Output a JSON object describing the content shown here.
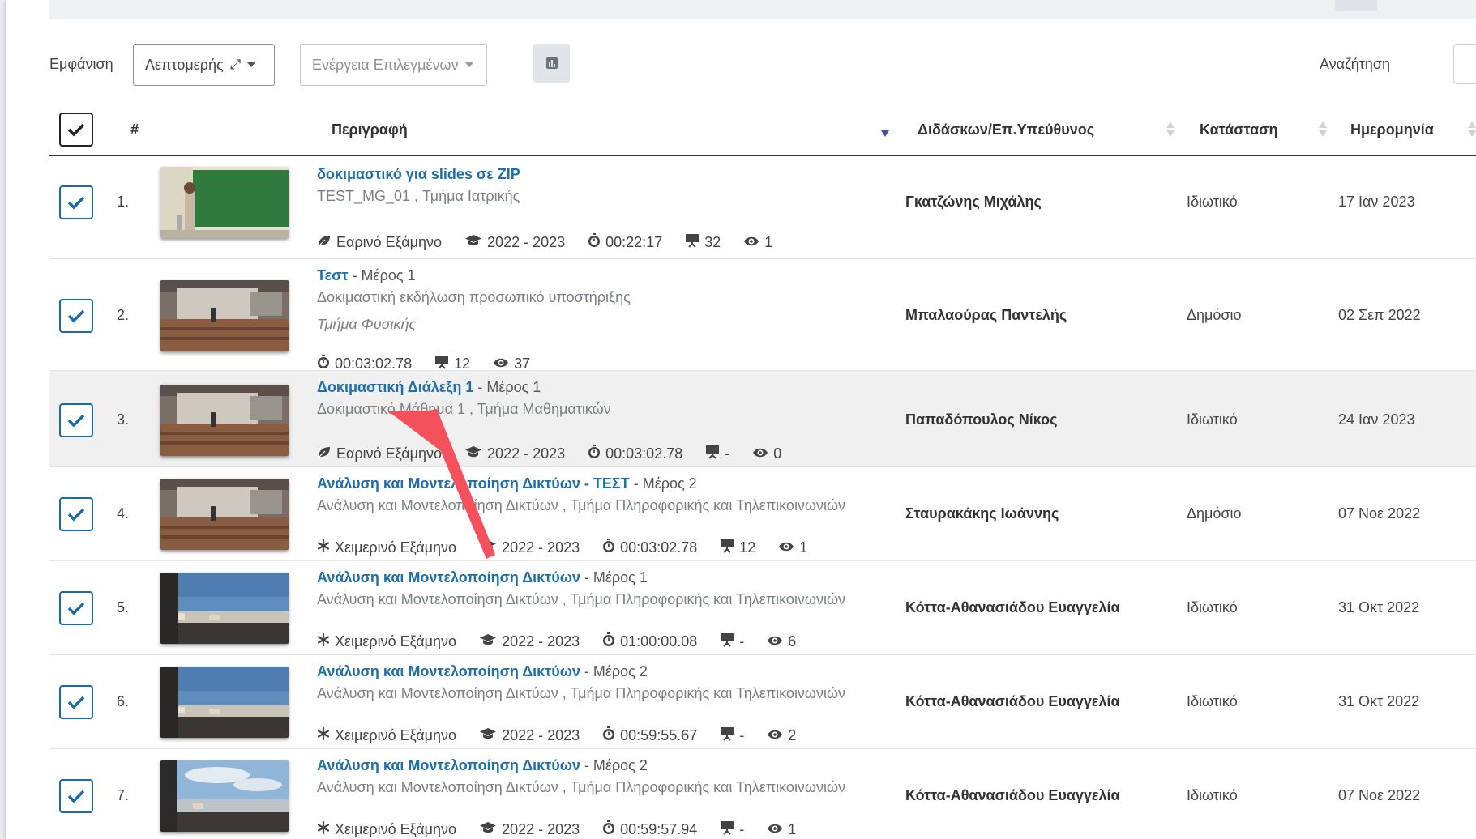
{
  "toolbar": {
    "view_label": "Εμφάνιση",
    "view_value": "Λεπτομερής",
    "bulk_action": "Ενέργεια Επιλεγμένων",
    "search_label": "Αναζήτηση",
    "search_value": ""
  },
  "table": {
    "headers": {
      "index": "#",
      "description": "Περιγραφή",
      "teacher": "Διδάσκων/Επ.Υπεύθυνος",
      "status": "Κατάσταση",
      "date": "Ημερομηνία"
    },
    "sorted_column": "description",
    "rows": [
      {
        "num": "1.",
        "title": "δοκιμαστικό για slides σε ZIP",
        "part": "",
        "subtitle": "TEST_MG_01 , Τμήμα Ιατρικής",
        "subtitle2": "",
        "semester": "Εαρινό Εξάμηνο",
        "semester_icon": "leaf-icon",
        "year": "2022 - 2023",
        "duration": "00:22:17",
        "slides": "32",
        "views": "1",
        "teacher": "Γκατζώνης Μιχάλης",
        "status": "Ιδιωτικό",
        "date": "17 Ιαν 2023",
        "thumb": "board"
      },
      {
        "num": "2.",
        "title": "Τεστ",
        "part": " - Μέρος 1",
        "subtitle": "Δοκιμαστική εκδήλωση προσωπικό υποστήριξης",
        "subtitle2": "Τμήμα Φυσικής",
        "semester": "",
        "semester_icon": "",
        "year": "",
        "duration": "00:03:02.78",
        "slides": "12",
        "views": "37",
        "teacher": "Μπαλαούρας Παντελής",
        "status": "Δημόσιο",
        "date": "02 Σεπ 2022",
        "thumb": "room"
      },
      {
        "num": "3.",
        "title": "Δοκιμαστική Διάλεξη 1",
        "part": " - Μέρος 1",
        "subtitle": "Δοκιμαστικό Μάθημα 1 , Τμήμα Μαθηματικών",
        "subtitle2": "",
        "semester": "Εαρινό Εξάμηνο",
        "semester_icon": "leaf-icon",
        "year": "2022 - 2023",
        "duration": "00:03:02.78",
        "slides": "-",
        "views": "0",
        "teacher": "Παπαδόπουλος Νίκος",
        "status": "Ιδιωτικό",
        "date": "24 Ιαν 2023",
        "thumb": "room"
      },
      {
        "num": "4.",
        "title": "Ανάλυση και Μοντελοποίηση Δικτύων - ΤΕΣΤ",
        "part": " - Μέρος 2",
        "subtitle": "Ανάλυση και Μοντελοποίηση Δικτύων , Τμήμα Πληροφορικής και Τηλεπικοινωνιών",
        "subtitle2": "",
        "semester": "Χειμερινό Εξάμηνο",
        "semester_icon": "snowflake-icon",
        "year": "2022 - 2023",
        "duration": "00:03:02.78",
        "slides": "12",
        "views": "1",
        "teacher": "Σταυρακάκης Ιωάννης",
        "status": "Δημόσιο",
        "date": "07 Νοε 2022",
        "thumb": "room"
      },
      {
        "num": "5.",
        "title": "Ανάλυση και Μοντελοποίηση Δικτύων",
        "part": " - Μέρος 1",
        "subtitle": "Ανάλυση και Μοντελοποίηση Δικτύων , Τμήμα Πληροφορικής και Τηλεπικοινωνιών",
        "subtitle2": "",
        "semester": "Χειμερινό Εξάμηνο",
        "semester_icon": "snowflake-icon",
        "year": "2022 - 2023",
        "duration": "01:00:00.08",
        "slides": "-",
        "views": "6",
        "teacher": "Κόττα-Αθανασιάδου Ευαγγελία",
        "status": "Ιδιωτικό",
        "date": "31 Οκτ 2022",
        "thumb": "sky"
      },
      {
        "num": "6.",
        "title": "Ανάλυση και Μοντελοποίηση Δικτύων",
        "part": " - Μέρος 2",
        "subtitle": "Ανάλυση και Μοντελοποίηση Δικτύων , Τμήμα Πληροφορικής και Τηλεπικοινωνιών",
        "subtitle2": "",
        "semester": "Χειμερινό Εξάμηνο",
        "semester_icon": "snowflake-icon",
        "year": "2022 - 2023",
        "duration": "00:59:55.67",
        "slides": "-",
        "views": "2",
        "teacher": "Κόττα-Αθανασιάδου Ευαγγελία",
        "status": "Ιδιωτικό",
        "date": "31 Οκτ 2022",
        "thumb": "sky"
      },
      {
        "num": "7.",
        "title": "Ανάλυση και Μοντελοποίηση Δικτύων",
        "part": " - Μέρος 2",
        "subtitle": "Ανάλυση και Μοντελοποίηση Δικτύων , Τμήμα Πληροφορικής και Τηλεπικοινωνιών",
        "subtitle2": "",
        "semester": "Χειμερινό Εξάμηνο",
        "semester_icon": "snowflake-icon",
        "year": "2022 - 2023",
        "duration": "00:59:57.94",
        "slides": "-",
        "views": "1",
        "teacher": "Κόττα-Αθανασιάδου Ευαγγελία",
        "status": "Ιδιωτικό",
        "date": "07 Νοε 2022",
        "thumb": "sky2"
      }
    ]
  },
  "colors": {
    "link": "#1f6fa8",
    "checkbox": "#1a6aa8",
    "annotation_arrow": "#f4515c",
    "highlight_row": "#f0f0f0"
  }
}
